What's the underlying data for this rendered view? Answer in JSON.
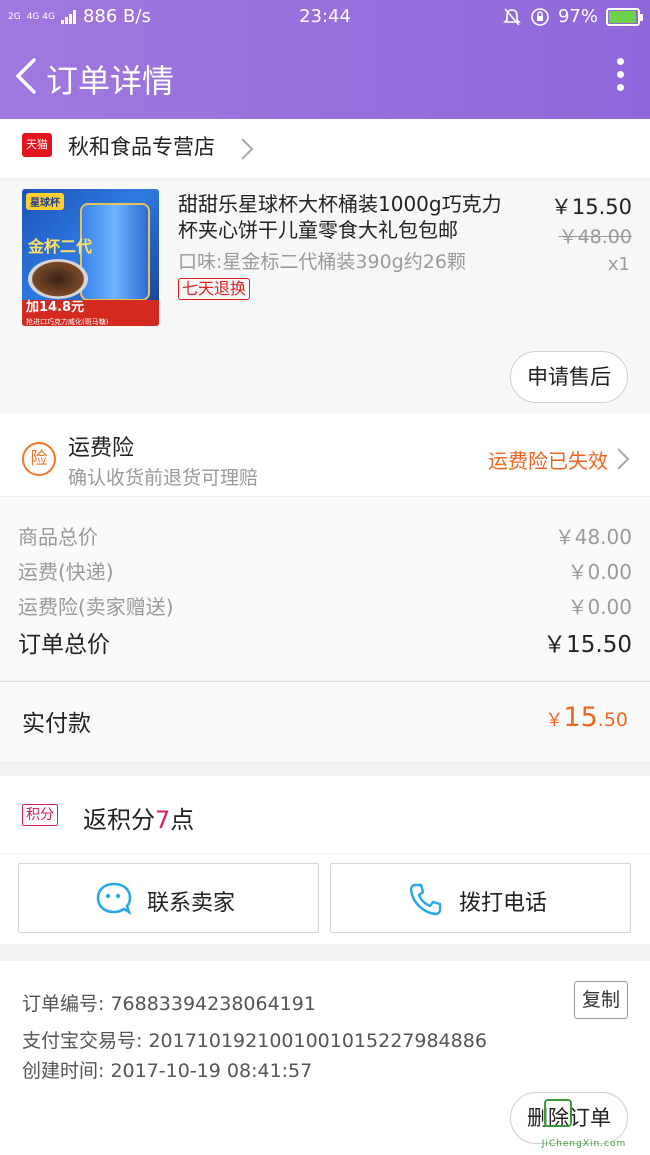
{
  "statusbar": {
    "net_top": "2G",
    "net_mid": "4G 4G",
    "speed": "886 B/s",
    "time": "23:44",
    "battery": "97%"
  },
  "nav": {
    "title": "订单详情"
  },
  "store": {
    "badge": "天猫",
    "name": "秋和食品专营店"
  },
  "product": {
    "title": "甜甜乐星球杯大杯桶装1000g巧克力杯夹心饼干儿童零食大礼包包邮",
    "spec": "口味:星金标二代桶装390g约26颗",
    "tag": "七天退换",
    "price": "￥15.50",
    "original_price": "￥48.00",
    "quantity": "x1",
    "image": {
      "badge": "星球杯",
      "label": "金杯二代",
      "promo": "加14.8元",
      "promo_sub": "抢进口巧克力威化(斑马糖)"
    },
    "after_sale_label": "申请售后"
  },
  "insurance": {
    "icon": "险",
    "title": "运费险",
    "subtitle": "确认收货前退货可理赔",
    "status": "运费险已失效"
  },
  "summary": {
    "rows": [
      {
        "label": "商品总价",
        "value": "￥48.00"
      },
      {
        "label": "运费(快递)",
        "value": "￥0.00"
      },
      {
        "label": "运费险(卖家赠送)",
        "value": "￥0.00"
      }
    ],
    "total_label": "订单总价",
    "total_value": "￥15.50"
  },
  "paid": {
    "label": "实付款",
    "currency": "￥",
    "int_part": "15",
    "dec_part": ".50"
  },
  "points": {
    "badge": "积分",
    "prefix": "返积分",
    "value": "7",
    "suffix": "点"
  },
  "actions": {
    "contact_label": "联系卖家",
    "call_label": "拨打电话"
  },
  "info": {
    "order_no": "订单编号: 76883394238064191",
    "alipay_no": "支付宝交易号: 2017101921001001015227984886",
    "created": "创建时间: 2017-10-19 08:41:57",
    "copy_label": "复制",
    "delete_label": "删除订单"
  },
  "watermark": "JiChengXin.com",
  "colors": {
    "header": "#9a70de",
    "accent": "#f0641e",
    "tmall": "#e5131d",
    "points": "#d6205a",
    "chat_icon": "#29a8e6"
  }
}
